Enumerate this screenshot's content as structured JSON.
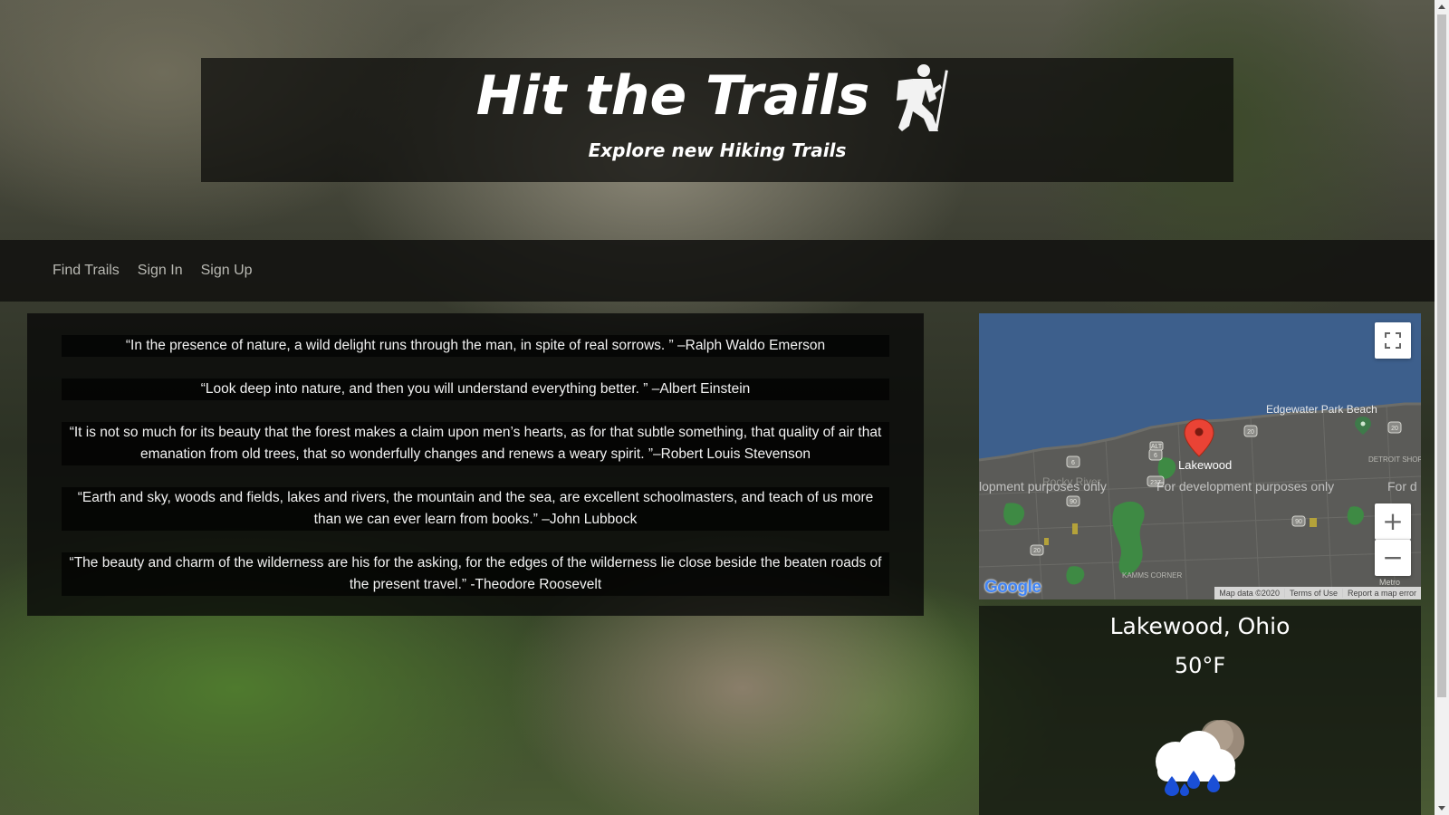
{
  "header": {
    "title": "Hit the Trails",
    "subtitle": "Explore new Hiking Trails",
    "logo_icon": "hiker-icon"
  },
  "nav": {
    "items": [
      {
        "label": "Find Trails"
      },
      {
        "label": "Sign In"
      },
      {
        "label": "Sign Up"
      }
    ]
  },
  "quotes": [
    "“In the presence of nature, a wild delight runs through the man, in spite of real sorrows. ” –Ralph Waldo Emerson",
    "“Look deep into nature, and then you will understand everything better. ” –Albert Einstein",
    "“It is not so much for its beauty that the forest makes a claim upon men’s hearts, as for that subtle something, that quality of air that emanation from old trees, that so wonderfully changes and renews a weary spirit. ”–Robert Louis Stevenson",
    "“Earth and sky, woods and fields, lakes and rivers, the mountain and the sea, are excellent schoolmasters, and teach of us more than we can ever learn from books.” –John Lubbock",
    "“The beauty and charm of the wilderness are his for the asking, for the edges of the wilderness lie close beside the beaten roads of the present travel.” -Theodore Roosevelt"
  ],
  "map": {
    "place_labels": {
      "edgewater": "Edgewater Park Beach",
      "lakewood": "Lakewood",
      "rocky_river": "Rocky River",
      "detroit_shoreway": "DETROIT SHOREWAY",
      "kamms_corner": "KAMMS CORNER",
      "metro": "Metro"
    },
    "route_shields": [
      "6",
      "6",
      "20",
      "20",
      "237",
      "90",
      "20",
      "90",
      "ALT"
    ],
    "dev_watermark": "For development purposes only",
    "dev_left": "lopment purposes only",
    "dev_right": "For d",
    "footer": {
      "map_data": "Map data ©2020",
      "terms": "Terms of Use",
      "report": "Report a map error"
    },
    "logo": "Google",
    "zoom_in": "+",
    "zoom_out": "−",
    "colors": {
      "water": "#3d5f8c",
      "land": "#5a5a58",
      "park": "#4a8a3a",
      "marker": "#ea4335"
    }
  },
  "weather": {
    "city": "Lakewood, Ohio",
    "temperature": "50°F",
    "icon": "rain-cloud-moon-icon"
  }
}
